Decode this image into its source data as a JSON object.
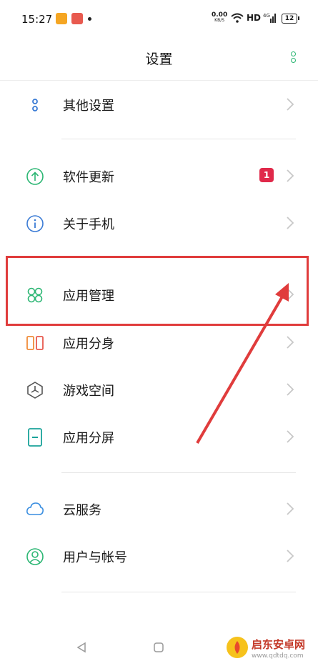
{
  "status_bar": {
    "time": "15:27",
    "net_speed_value": "0.00",
    "net_speed_unit": "KB/S",
    "network_type": "HD",
    "signal_label": "4G",
    "battery": "12"
  },
  "header": {
    "title": "设置",
    "more_icon": "more-vertical-icon"
  },
  "settings_items": [
    {
      "label": "其他设置",
      "icon": "more-settings-icon"
    },
    {
      "label": "软件更新",
      "icon": "update-icon",
      "badge": "1"
    },
    {
      "label": "关于手机",
      "icon": "info-icon"
    },
    {
      "label": "应用管理",
      "icon": "app-grid-icon"
    },
    {
      "label": "应用分身",
      "icon": "app-clone-icon"
    },
    {
      "label": "游戏空间",
      "icon": "game-space-icon"
    },
    {
      "label": "应用分屏",
      "icon": "split-screen-icon"
    },
    {
      "label": "云服务",
      "icon": "cloud-icon"
    },
    {
      "label": "用户与帐号",
      "icon": "user-account-icon"
    }
  ],
  "watermark": {
    "text": "启东安卓网",
    "url": "www.qdtdq.com"
  },
  "colors": {
    "accent": "#2bb673",
    "badge": "#e0294a",
    "annotation": "#e03c3c",
    "icon_blue": "#3a7bd5",
    "icon_orange": "#f08c3a"
  }
}
